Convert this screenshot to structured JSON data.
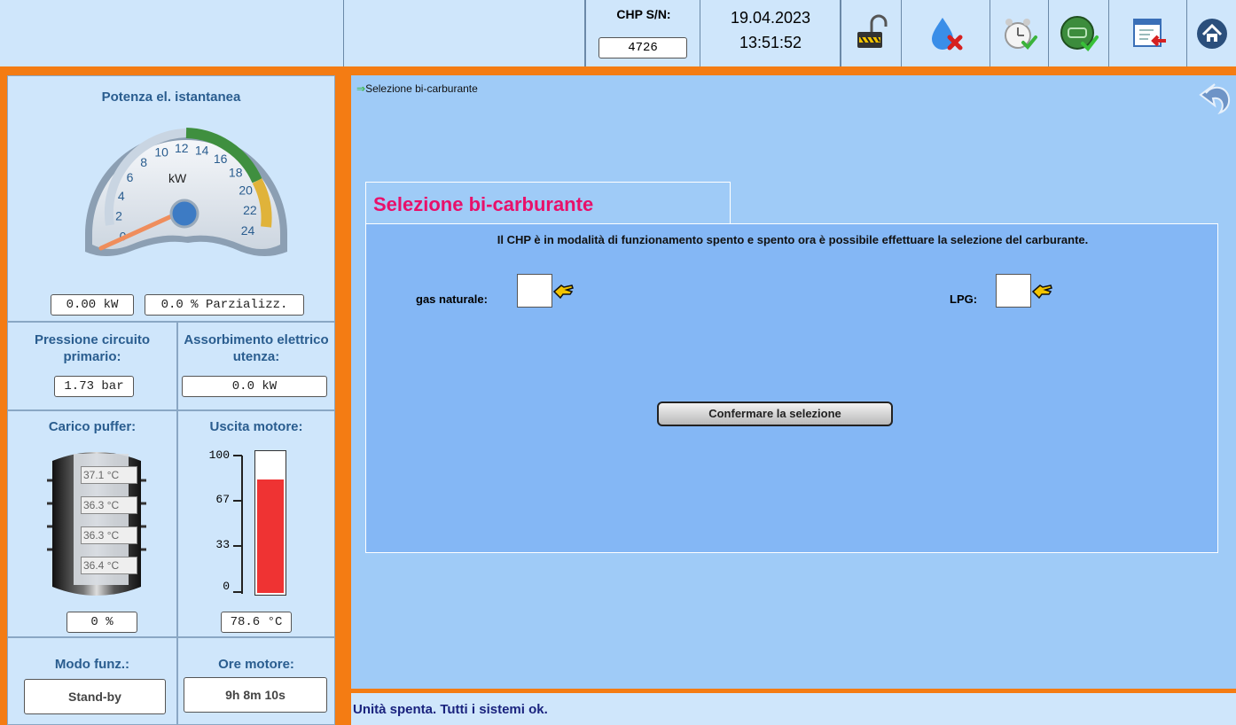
{
  "header": {
    "serial_label": "CHP S/N:",
    "serial_value": "4726",
    "date": "19.04.2023",
    "time": "13:51:52",
    "icons": [
      "padlock-open-icon",
      "fuel-drop-cancel-icon",
      "alarm-clock-check-icon",
      "engine-check-icon",
      "window-exit-icon",
      "home-icon"
    ]
  },
  "left": {
    "power": {
      "title": "Potenza el. istantanea",
      "unit_label": "kW",
      "ticks": [
        "0",
        "2",
        "4",
        "6",
        "8",
        "10",
        "12",
        "14",
        "16",
        "18",
        "20",
        "22",
        "24"
      ],
      "value": 0.0,
      "value_text": "0.00 kW",
      "partial_text": "0.0 % Parzializz."
    },
    "pressure": {
      "title": "Pressione circuito primario:",
      "value": "1.73 bar"
    },
    "absorption": {
      "title": "Assorbimento elettrico utenza:",
      "value": "0.0 kW"
    },
    "buffer": {
      "title": "Carico puffer:",
      "temps": [
        "37.1 °C",
        "36.3 °C",
        "36.3 °C",
        "36.4 °C"
      ],
      "percent": "0 %"
    },
    "engine_out": {
      "title": "Uscita motore:",
      "scale": [
        "100",
        "67",
        "33",
        "0"
      ],
      "level": 0.81,
      "value": "78.6 °C"
    },
    "mode": {
      "title": "Modo funz.:",
      "value": "Stand-by"
    },
    "hours": {
      "title": "Ore motore:",
      "value": "9h 8m 10s"
    }
  },
  "main": {
    "breadcrumb": "Selezione bi-carburante",
    "panel_title": "Selezione bi-carburante",
    "message": "Il CHP è in modalità di funzionamento spento e spento ora è possibile effettuare la selezione del carburante.",
    "option_gas": "gas naturale:",
    "option_lpg": "LPG:",
    "confirm_label": "Confermare la selezione"
  },
  "status": {
    "text": "Unità spenta. Tutti i sistemi ok."
  },
  "colors": {
    "orange_frame": "#f47c13",
    "panel_title": "#e8106a",
    "main_bg": "#9fcbf7",
    "inner_bg": "#84b7f5",
    "label_blue": "#2a5d8f"
  }
}
